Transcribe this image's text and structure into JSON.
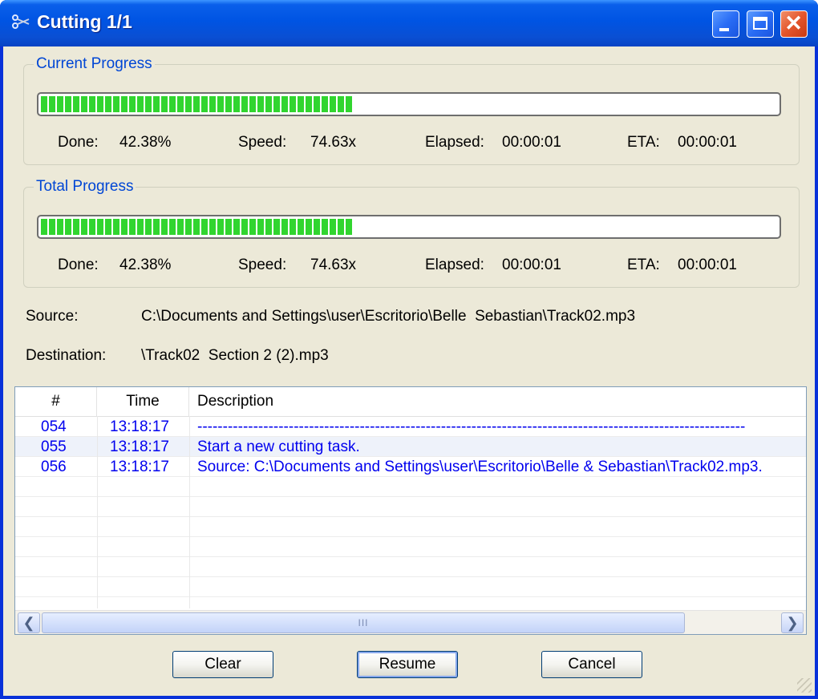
{
  "window": {
    "title": "Cutting 1/1",
    "title_icon": "scissors-icon",
    "controls": {
      "minimize": "minimize-icon",
      "maximize": "maximize-icon",
      "close": "✕"
    }
  },
  "current": {
    "label": "Current Progress",
    "progress_fraction": 0.4238,
    "done_label": "Done:",
    "done_value": "42.38%",
    "speed_label": "Speed:",
    "speed_value": "74.63x",
    "elapsed_label": "Elapsed:",
    "elapsed_value": "00:00:01",
    "eta_label": "ETA:",
    "eta_value": "00:00:01"
  },
  "total": {
    "label": "Total Progress",
    "progress_fraction": 0.4238,
    "done_label": "Done:",
    "done_value": "42.38%",
    "speed_label": "Speed:",
    "speed_value": "74.63x",
    "elapsed_label": "Elapsed:",
    "elapsed_value": "00:00:01",
    "eta_label": "ETA:",
    "eta_value": "00:00:01"
  },
  "source": {
    "label": "Source:",
    "value": "C:\\Documents and Settings\\user\\Escritorio\\Belle  Sebastian\\Track02.mp3"
  },
  "destination": {
    "label": "Destination:",
    "value": "\\Track02  Section 2 (2).mp3"
  },
  "log": {
    "columns": [
      "#",
      "Time",
      "Description"
    ],
    "rows": [
      {
        "num": "054",
        "time": "13:18:17",
        "desc": "------------------------------------------------------------------------------------------------------------"
      },
      {
        "num": "055",
        "time": "13:18:17",
        "desc": "Start a new cutting task."
      },
      {
        "num": "056",
        "time": "13:18:17",
        "desc": "Source:  C:\\Documents and Settings\\user\\Escritorio\\Belle & Sebastian\\Track02.mp3."
      }
    ],
    "scroll_thumb_grip": "III"
  },
  "buttons": {
    "clear": "Clear",
    "resume": "Resume",
    "cancel": "Cancel"
  },
  "colors": {
    "progress": "#31d52f",
    "log_text": "#0000ee",
    "group_label": "#0046d5",
    "titlebar": "#0054e3"
  }
}
